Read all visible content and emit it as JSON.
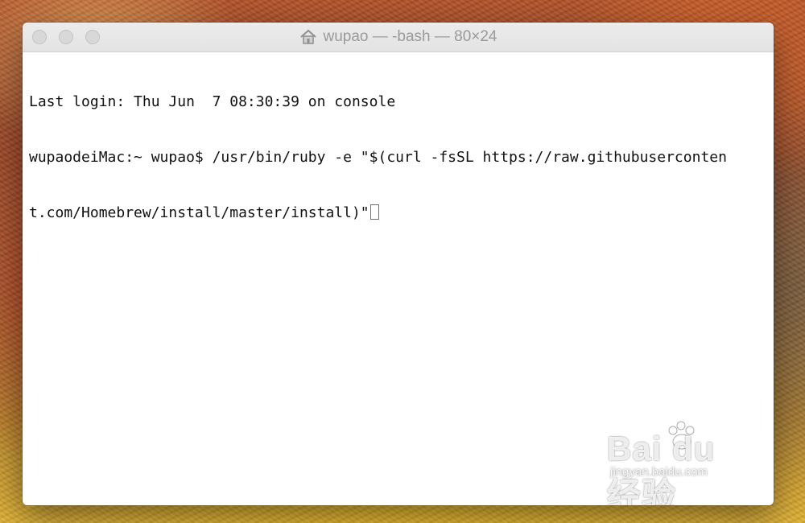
{
  "window": {
    "title": "wupao — -bash — 80×24",
    "home_icon": "home-icon"
  },
  "terminal": {
    "lines": [
      "Last login: Thu Jun  7 08:30:39 on console",
      "wupaodeiMac:~ wupao$ /usr/bin/ruby -e \"$(curl -fsSL https://raw.githubuserconten",
      "t.com/Homebrew/install/master/install)\""
    ]
  },
  "watermark": {
    "logo": "Bai du 经验",
    "site": "jingyan.baidu.com"
  },
  "colors": {
    "terminal_background": "#ffffff",
    "terminal_text": "#111111",
    "titlebar": "#e6e6e6",
    "traffic_light_inactive": "#d8d8d8"
  }
}
